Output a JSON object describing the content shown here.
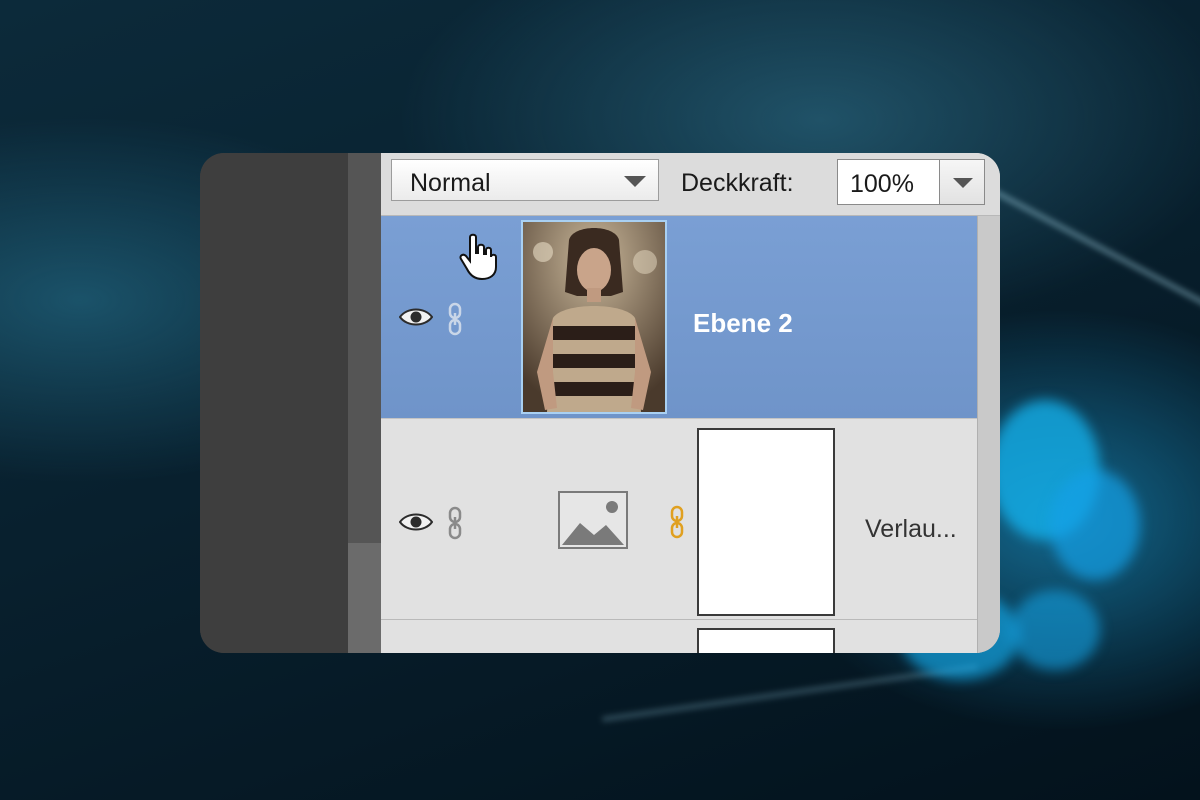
{
  "toolbar": {
    "blend_mode": "Normal",
    "opacity_label": "Deckkraft:",
    "opacity_value": "100%"
  },
  "layers": [
    {
      "name": "Ebene 2",
      "selected": true,
      "thumbnail": "photo-thumbnail",
      "visible": true
    },
    {
      "name": "Verlau...",
      "selected": false,
      "thumbnail": "image-placeholder-icon",
      "mask": "white-mask",
      "visible": true
    }
  ],
  "colors": {
    "selected_row": "#7a9fd4",
    "panel_bg": "#dedede",
    "mask_link": "#e0a020"
  },
  "icons": [
    "eye-icon",
    "chain-link-icon",
    "image-placeholder-icon",
    "hand-cursor-icon",
    "chevron-down-icon"
  ]
}
